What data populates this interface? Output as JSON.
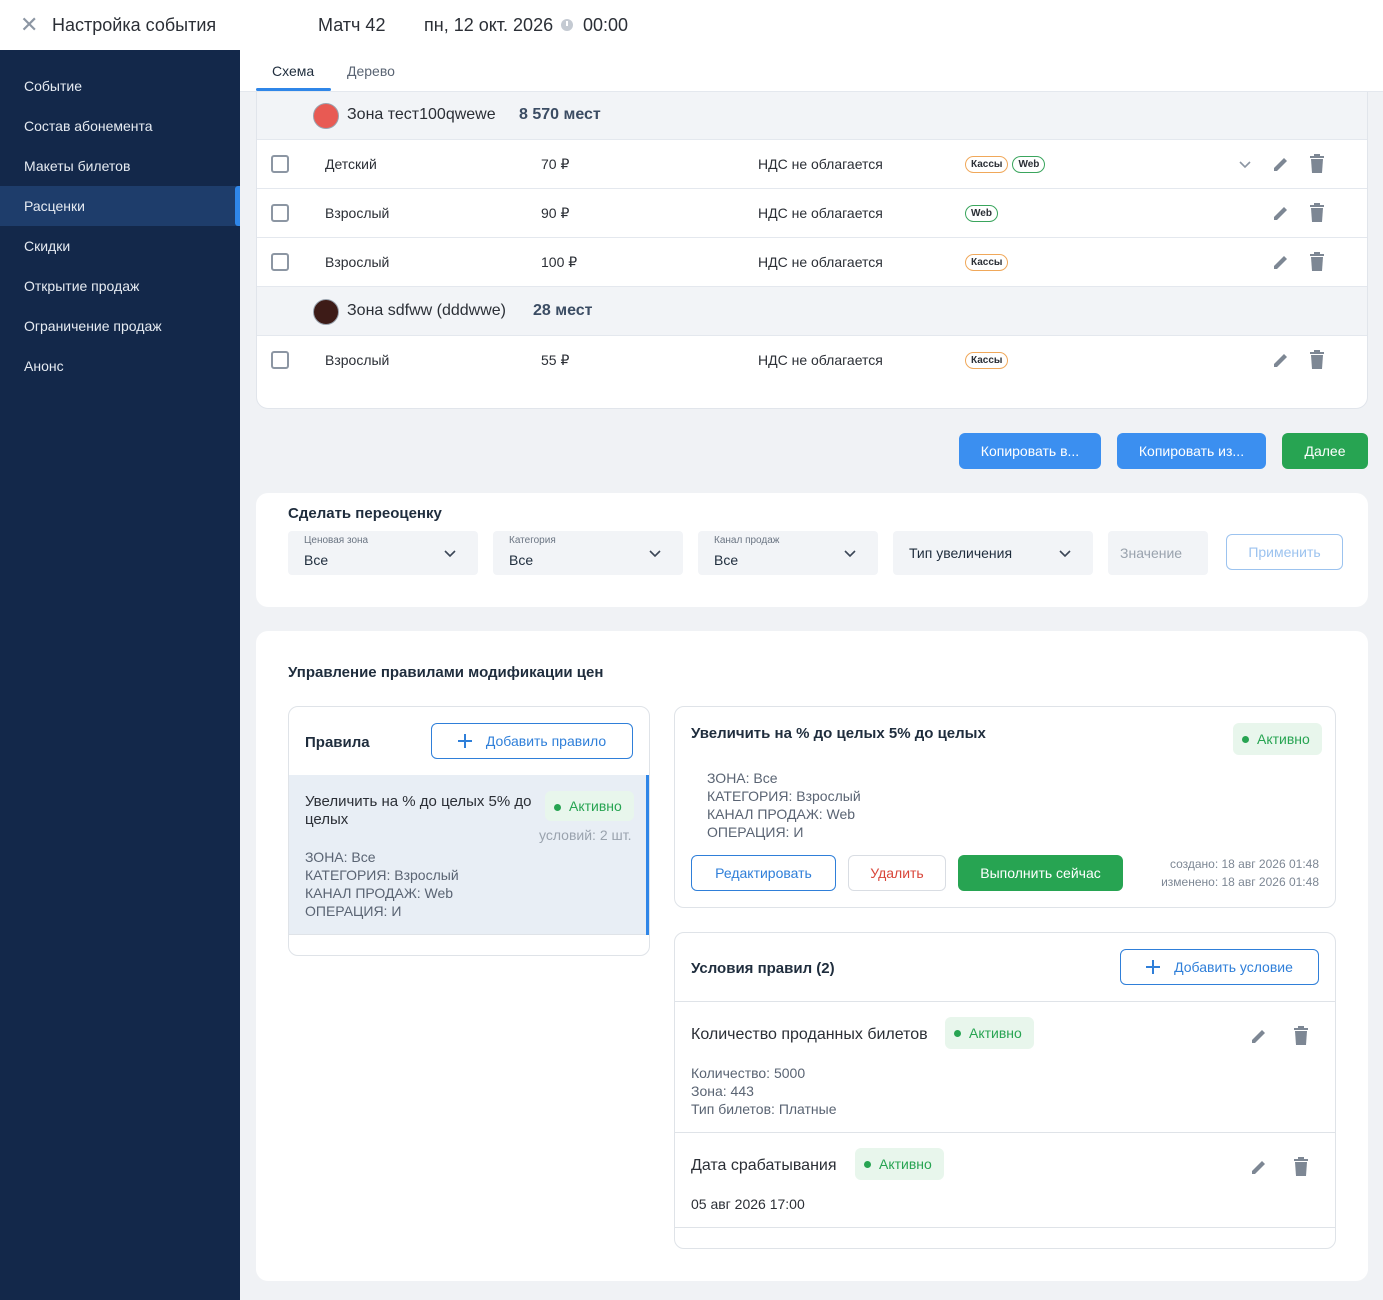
{
  "header": {
    "title": "Настройка события",
    "event_name": "Матч 42",
    "event_date": "пн, 12 окт. 2026",
    "event_time": "00:00"
  },
  "sidebar": {
    "items": [
      {
        "label": "Событие"
      },
      {
        "label": "Состав абонемента"
      },
      {
        "label": "Макеты билетов"
      },
      {
        "label": "Расценки",
        "active": true
      },
      {
        "label": "Скидки"
      },
      {
        "label": "Открытие продаж"
      },
      {
        "label": "Ограничение продаж"
      },
      {
        "label": "Анонс"
      }
    ]
  },
  "tabs": [
    {
      "label": "Схема",
      "active": true
    },
    {
      "label": "Дерево"
    }
  ],
  "zones": [
    {
      "name": "Зона тест100qwewe",
      "seats": "8 570 мест",
      "color": "#e85a53",
      "rows": [
        {
          "type": "Детский",
          "price": "70 ₽",
          "vat": "НДС не облагается",
          "channels": [
            "Кассы",
            "Web"
          ],
          "expandable": true
        },
        {
          "type": "Взрослый",
          "price": "90 ₽",
          "vat": "НДС не облагается",
          "channels": [
            "Web"
          ]
        },
        {
          "type": "Взрослый",
          "price": "100 ₽",
          "vat": "НДС не облагается",
          "channels": [
            "Кассы"
          ]
        }
      ]
    },
    {
      "name": "Зона sdfww (dddwwe)",
      "seats": "28 мест",
      "color": "#3d1b17",
      "rows": [
        {
          "type": "Взрослый",
          "price": "55 ₽",
          "vat": "НДС не облагается",
          "channels": [
            "Кассы"
          ]
        }
      ]
    }
  ],
  "actions": {
    "copy_to": "Копировать в...",
    "copy_from": "Копировать из...",
    "next": "Далее"
  },
  "reprice": {
    "title": "Сделать переоценку",
    "price_zone": {
      "label": "Ценовая зона",
      "value": "Все"
    },
    "category": {
      "label": "Категория",
      "value": "Все"
    },
    "channel": {
      "label": "Канал продаж",
      "value": "Все"
    },
    "increase_type": {
      "placeholder": "Тип увеличения"
    },
    "value_placeholder": "Значение",
    "apply": "Применить"
  },
  "rules_mgmt": {
    "title": "Управление правилами модификации цен",
    "rules_panel": {
      "title": "Правила",
      "add_rule": "Добавить правило",
      "rule": {
        "title": "Увеличить на % до целых 5% до целых",
        "status": "Активно",
        "conditions_count": "условий: 2 шт.",
        "zone": "ЗОНА:  Все",
        "category": "КАТЕГОРИЯ:  Взрослый",
        "channel": "КАНАЛ ПРОДАЖ:  Web",
        "operation": "ОПЕРАЦИЯ:  И"
      }
    },
    "detail": {
      "title": "Увеличить на % до целых 5% до целых",
      "status": "Активно",
      "zone": "ЗОНА:  Все",
      "category": "КАТЕГОРИЯ:  Взрослый",
      "channel": "КАНАЛ ПРОДАЖ:  Web",
      "operation": "ОПЕРАЦИЯ:  И",
      "edit": "Редактировать",
      "delete": "Удалить",
      "run_now": "Выполнить сейчас",
      "created": "создано: 18 авг 2026 01:48",
      "modified": "изменено: 18 авг 2026 01:48"
    },
    "conditions": {
      "title": "Условия правил (2)",
      "add_condition": "Добавить условие",
      "items": [
        {
          "title": "Количество проданных билетов",
          "status": "Активно",
          "lines": [
            "Количество: 5000",
            "Зона: 443",
            "Тип билетов: Платные"
          ]
        },
        {
          "title": "Дата срабатывания",
          "status": "Активно",
          "lines": [
            "05 авг 2026 17:00"
          ]
        }
      ]
    }
  }
}
